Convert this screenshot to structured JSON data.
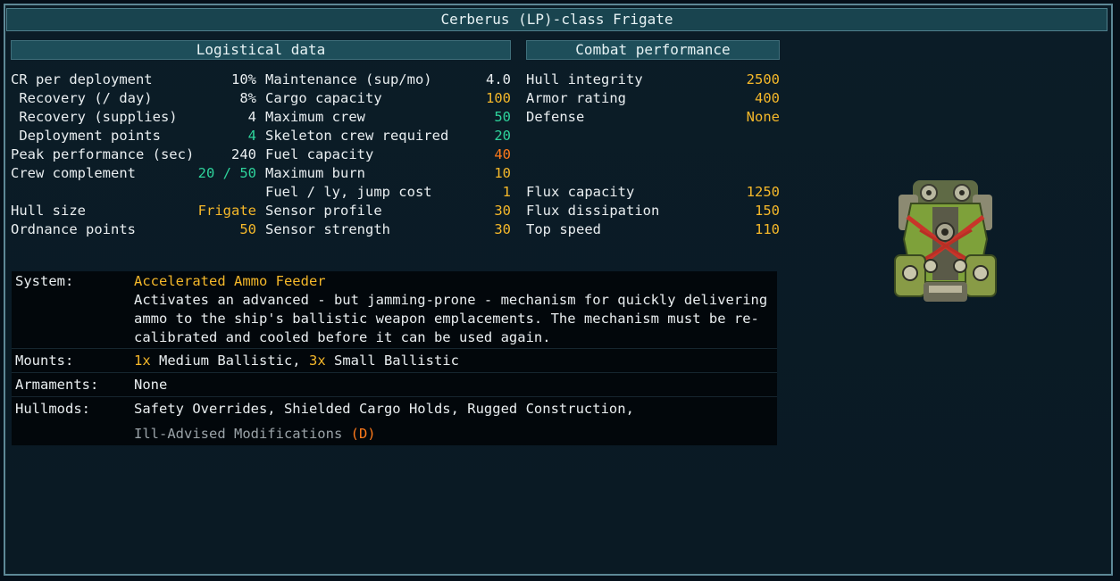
{
  "title": "Cerberus (LP)-class Frigate",
  "sections": {
    "logistical": "Logistical data",
    "combat": "Combat performance"
  },
  "logistics_col1": [
    {
      "label": "CR per deployment",
      "value": "10%"
    },
    {
      "label": " Recovery (/ day)",
      "value": "8%"
    },
    {
      "label": " Recovery (supplies)",
      "value": "4"
    },
    {
      "label": " Deployment points",
      "value": "4"
    },
    {
      "label": "Peak performance (sec)",
      "value": "240"
    },
    {
      "label": "Crew complement",
      "value_a": "20",
      "value_sep": " / ",
      "value_b": "50"
    },
    {
      "label": "Hull size",
      "value": "Frigate"
    },
    {
      "label": "Ordnance points",
      "value": "50"
    }
  ],
  "logistics_col2": [
    {
      "label": "Maintenance (sup/mo)",
      "value": "4.0"
    },
    {
      "label": "Cargo capacity",
      "value": "100"
    },
    {
      "label": "Maximum crew",
      "value": "50"
    },
    {
      "label": "Skeleton crew required",
      "value": "20"
    },
    {
      "label": "Fuel capacity",
      "value": "40"
    },
    {
      "label": "Maximum burn",
      "value": "10"
    },
    {
      "label": "Fuel / ly, jump cost",
      "value": "1"
    },
    {
      "label": "Sensor profile",
      "value": "30"
    },
    {
      "label": "Sensor strength",
      "value": "30"
    }
  ],
  "combat": [
    {
      "label": "Hull integrity",
      "value": "2500"
    },
    {
      "label": "Armor rating",
      "value": "400"
    },
    {
      "label": "Defense",
      "value": "None"
    },
    {
      "label": "Flux capacity",
      "value": "1250"
    },
    {
      "label": "Flux dissipation",
      "value": "150"
    },
    {
      "label": "Top speed",
      "value": "110"
    }
  ],
  "system": {
    "label": "System:",
    "name": "Accelerated Ammo Feeder",
    "desc_lines": [
      "Activates an advanced - but jamming-prone - mechanism for quickly delivering",
      "ammo to the ship's ballistic weapon emplacements. The mechanism must be re-",
      "calibrated and cooled before it can be used again."
    ]
  },
  "mounts": {
    "label": "Mounts:",
    "count1": "1x",
    "text1": " Medium Ballistic, ",
    "count2": "3x",
    "text2": " Small Ballistic"
  },
  "armaments": {
    "label": "Armaments:",
    "value": "None"
  },
  "hullmods": {
    "label": "Hullmods:",
    "line1": "Safety Overrides, Shielded Cargo Holds, Rugged Construction,",
    "line2": "Ill-Advised Modifications",
    "dmod": "(D)"
  },
  "colors": {
    "accent": "#f5b82a",
    "teal": "#2ed39b",
    "orange": "#ff7a1a",
    "header_bg": "#1e4e5a"
  },
  "ship_icon": "frigate-sprite"
}
